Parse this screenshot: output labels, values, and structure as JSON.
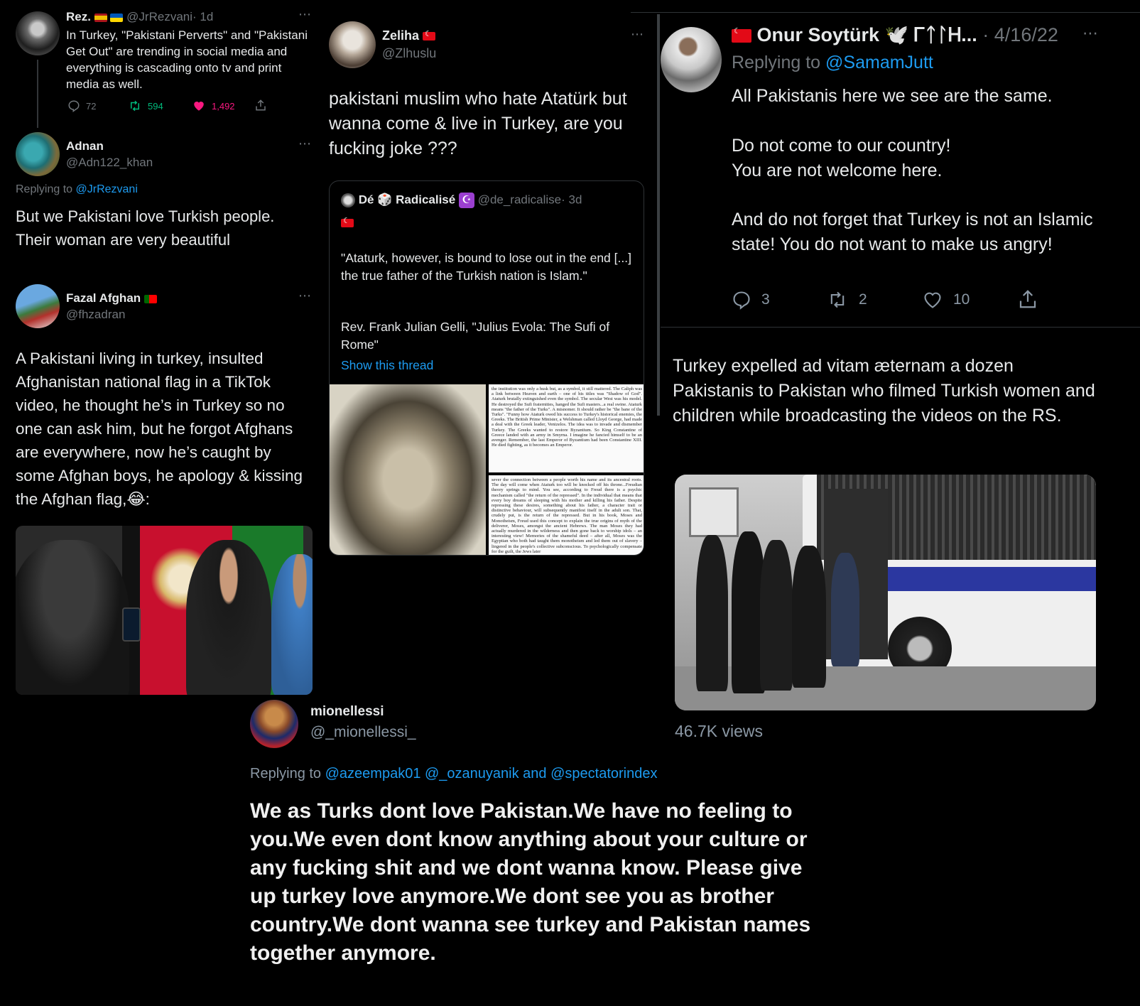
{
  "tweet1": {
    "name": "Rez.",
    "handle": "@JrRezvani",
    "time": "· 1d",
    "text": "In Turkey, \"Pakistani Perverts\" and \"Pakistani Get Out\" are trending in social media and everything is cascading onto tv and print media as well.",
    "replies": "72",
    "retweets": "594",
    "likes": "1,492"
  },
  "tweet2": {
    "name": "Adnan",
    "handle": "@Adn122_khan",
    "replying_prefix": "Replying to",
    "replying_to": "@JrRezvani",
    "text": "But we Pakistani love Turkish people. Their woman are very beautiful"
  },
  "tweet3": {
    "name": "Fazal Afghan",
    "handle": "@fhzadran",
    "text": "A Pakistani living in turkey, insulted Afghanistan national flag in a TikTok video, he thought he’s in Turkey so no one can ask him, but he forgot Afghans are everywhere, now he’s caught by some Afghan boys, he apology & kissing the Afghan flag,😂:"
  },
  "tweet4": {
    "name": "Zeliha",
    "handle": "@Zlhuslu",
    "text": "pakistani muslim who hate Atatürk but wanna come & live in Turkey, are you fucking joke ???",
    "quote": {
      "name_prefix": "Dé",
      "name_suffix": "Radicalisé",
      "handle": "@de_radicalise",
      "time": "· 3d",
      "quote_text": "\"Ataturk, however, is bound to lose out in the end [...] the true father of the Turkish nation is Islam.\"",
      "source_text": "Rev. Frank Julian Gelli, \"Julius Evola: The Sufi of Rome\"",
      "show_thread": "Show this thread",
      "page_top_text": "the institution was only a husk but, as a symbol, it still mattered. The Caliph was a link between Heaven and earth – one of his titles was \"Shadow of God\". Ataturk brutally extinguished even the symbol. The secular West was his model. He destroyed the Sufi fraternities, hanged the Sufi masters...a real swine. Ataturk means \"the father of the Turks\". A misnomer. It should rather be \"the bane of the Turks\". \"Funny how Ataturk owed his success to Turkey's historical enemies, the Greeks. The British Prime Minister, a Welshman called Lloyd George, had made a deal with the Greek leader, Venizelos. The idea was to invade and dismember Turkey. The Greeks wanted to restore Byzantium. So King Constantine of Greece landed with an army in Smyrna. I imagine he fancied himself to be an avenger. Remember, the last Emperor of Byzantium had been Constantine XIII. He died fighting, as it becomes an Emperor.",
      "page_bottom_text": "sever the connection between a people worth his name and its ancestral roots. The day will come when Ataturk too will be knocked off his throne...Freudian theory springs to mind. You see, according to Freud there is a psychic mechanism called \"the return of the repressed\". In the individual that means that every boy dreams of sleeping with his mother and killing his father. Despite repressing these desires, something about his father, a character trait or distinctive behaviour, will subsequently manifest itself in the adult son. That, crudely put, is the return of the repressed. But in his book, Moses and Monotheism, Freud used this concept to explain the true origins of myth of the deliverer, Moses, amongst the ancient Hebrews. The man Moses they had actually murdered in the wilderness and then gone back to worship idols – an interesting view! Memories of the shameful deed – after all, Moses was the Egyptian who both had taught them monotheism and led them out of slavery – lingered in the people's collective subconscious. To psychologically compensate for the guilt, the Jews later"
    }
  },
  "tweet5": {
    "name": "Onur Soytürk",
    "name_extra": "🕊️ ᎱᛏᛚᎻ...",
    "time": "· 4/16/22",
    "replying_prefix": "Replying to",
    "replying_to": "@SamamJutt",
    "text_p1": "All Pakistanis here we see are the same.",
    "text_p2a": "Do not come to our country!",
    "text_p2b": "You are not welcome here.",
    "text_p3": "And do not forget that Turkey is not an Islamic state! You do not want to make us angry!",
    "replies": "3",
    "retweets": "2",
    "likes": "10"
  },
  "tweet6": {
    "text": "Turkey expelled ad vitam æternam a dozen Pakistanis to Pakistan who filmed Turkish women and children while broadcasting the videos on the RS.",
    "views": "46.7K views"
  },
  "tweet7": {
    "name": "mionellessi",
    "handle": "@_mionellessi_",
    "replying_prefix": "Replying to",
    "replying_to": "@azeempak01 @_ozanuyanik and @spectatorindex",
    "text": "We as Turks dont love Pakistan.We have no feeling to you.We even dont know anything about your culture or any fucking shit and we dont wanna know. Please give up turkey love anymore.We dont see you as brother country.We dont wanna see turkey and Pakistan names together anymore."
  },
  "icons": {
    "more": "⋯",
    "dice": "🎲",
    "crescent": "☪"
  },
  "colors": {
    "background": "#000000",
    "text": "#e7e9ea",
    "muted": "#71767b",
    "link": "#1d9bf0",
    "like_pink": "#f91880",
    "retweet_green": "#00ba7c"
  }
}
